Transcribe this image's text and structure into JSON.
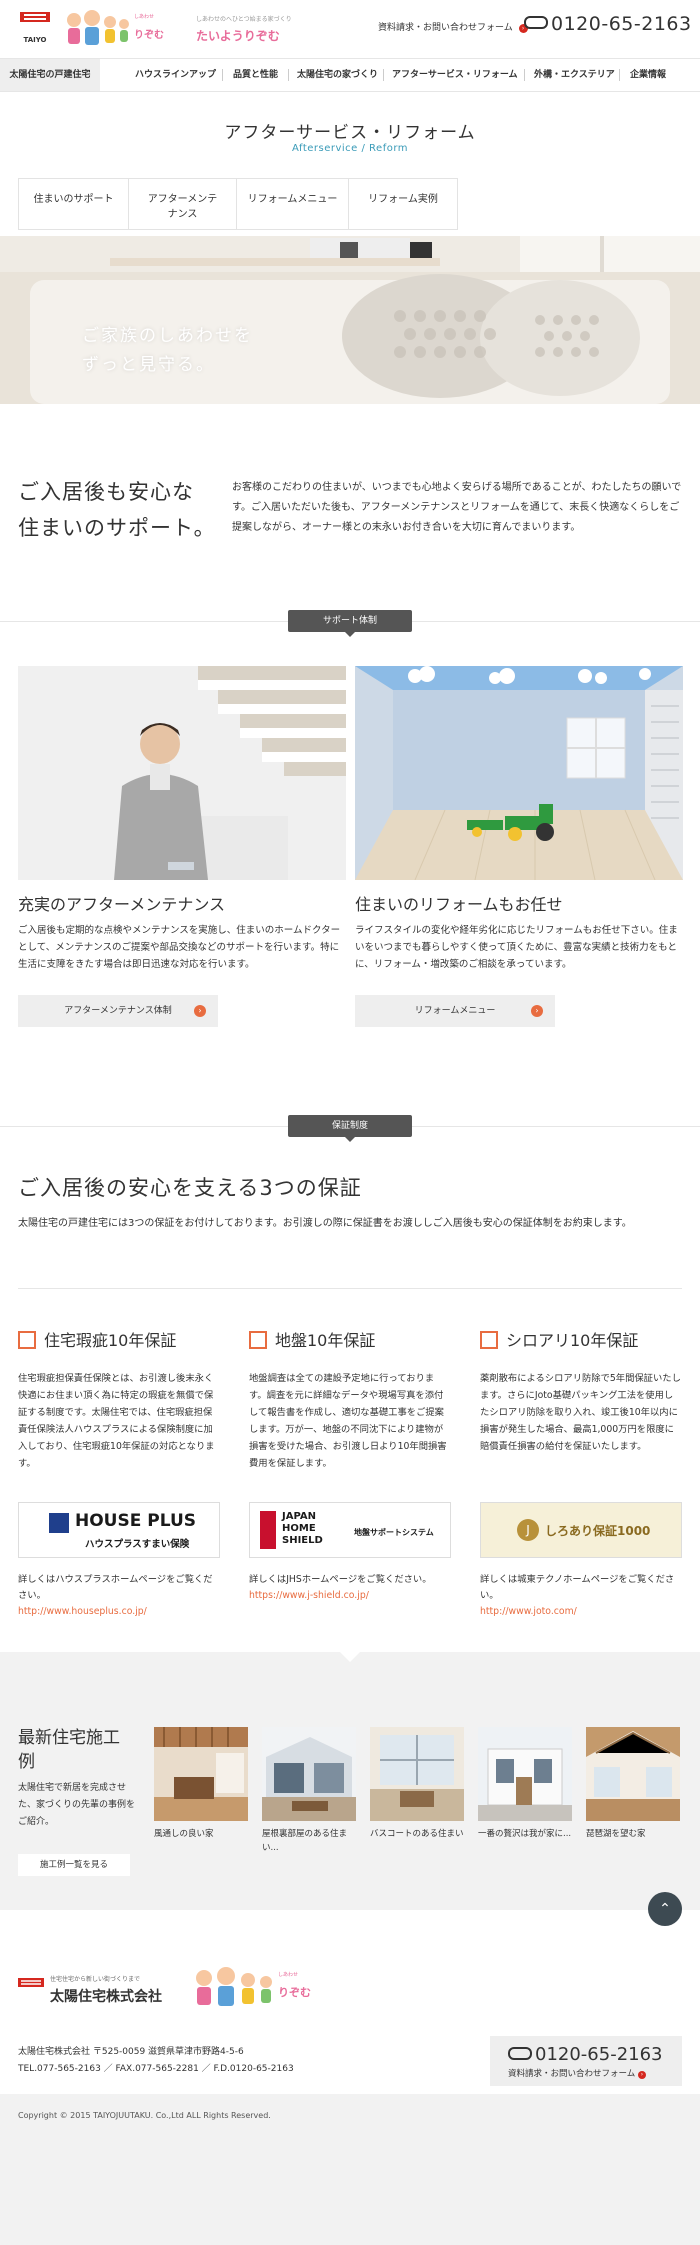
{
  "header": {
    "logo_text": "TAIYO",
    "tagline": "しあわせのへひとつ始まる家づくり",
    "brand_small": "たいようりぞむ",
    "inquiry_link": "資料請求・お問い合わせフォーム",
    "tel": "0120-65-2163"
  },
  "global_nav": {
    "current": "太陽住宅の戸建住宅",
    "items": [
      "ハウスラインアップ",
      "品質と性能",
      "太陽住宅の家づくり",
      "アフターサービス・リフォーム",
      "外構・エクステリア",
      "企業情報"
    ]
  },
  "page": {
    "title": "アフターサービス・リフォーム",
    "subtitle": "Afterservice / Reform"
  },
  "local_nav": [
    {
      "label": "住まいのサポート"
    },
    {
      "label": "アフターメンテナンス"
    },
    {
      "label": "リフォームメニュー"
    },
    {
      "label": "リフォーム実例"
    }
  ],
  "hero": {
    "line1": "ご家族のしあわせを",
    "line2": "ずっと見守る。"
  },
  "intro": {
    "heading1": "ご入居後も安心な",
    "heading2": "住まいのサポート。",
    "body": "お客様のこだわりの住まいが、いつまでも心地よく安らげる場所であることが、わたしたちの願いです。ご入居いただいた後も、アフターメンテナンスとリフォームを通じて、末長く快適なくらしをご提案しながら、オーナー様との末永いお付き合いを大切に育んでまいります。"
  },
  "support": {
    "label": "サポート体制",
    "cards": [
      {
        "title": "充実のアフターメンテナンス",
        "body": "ご入居後も定期的な点検やメンテナンスを実施し、住まいのホームドクターとして、メンテナンスのご提案や部品交換などのサポートを行います。特に生活に支障をきたす場合は即日迅速な対応を行います。",
        "button": "アフターメンテナンス体制"
      },
      {
        "title": "住まいのリフォームもお任せ",
        "body": "ライフスタイルの変化や経年劣化に応じたリフォームもお任せ下さい。住まいをいつまでも暮らしやすく使って頂くために、豊富な実績と技術力をもとに、リフォーム・増改築のご相談を承っています。",
        "button": "リフォームメニュー"
      }
    ]
  },
  "warranty": {
    "label": "保証制度",
    "heading": "ご入居後の安心を支える3つの保証",
    "body": "太陽住宅の戸建住宅には3つの保証をお付けしております。お引渡しの際に保証書をお渡ししご入居後も安心の保証体制をお約束します。",
    "items": [
      {
        "title": "住宅瑕疵10年保証",
        "body": "住宅瑕疵担保責任保険とは、お引渡し後末永く快適にお住まい頂く為に特定の瑕疵を無償で保証する制度です。太陽住宅では、住宅瑕疵担保責任保険法人ハウスプラスによる保険制度に加入しており、住宅瑕疵10年保証の対応となります。",
        "banner_main": "HOUSE PLUS",
        "banner_sub": "ハウスプラスすまい保険",
        "detail": "詳しくはハウスプラスホームページをご覧ください。",
        "url": "http://www.houseplus.co.jp/"
      },
      {
        "title": "地盤10年保証",
        "body": "地盤調査は全ての建設予定地に行っております。調査を元に詳細なデータや現場写真を添付して報告書を作成し、適切な基礎工事をご提案します。万が一、地盤の不同沈下により建物が損害を受けた場合、お引渡し日より10年間損害費用を保証します。",
        "banner_main": "JAPAN HOME SHIELD",
        "banner_sub": "地盤サポートシステム",
        "detail": "詳しくはJHSホームページをご覧ください。",
        "url": "https://www.j-shield.co.jp/"
      },
      {
        "title": "シロアリ10年保証",
        "body": "薬剤散布によるシロアリ防除で5年間保証いたします。さらにJoto基礎パッキング工法を使用したシロアリ防除を取り入れ、竣工後10年以内に損害が発生した場合、最高1,000万円を限度に賠償責任損害の給付を保証いたします。",
        "banner_main": "しろあり保証1000",
        "banner_sub": "",
        "detail": "詳しくは城東テクノホームページをご覧ください。",
        "url": "http://www.joto.com/"
      }
    ]
  },
  "works": {
    "heading1": "最新住宅施工",
    "heading2": "例",
    "body": "太陽住宅で新居を完成させた、家づくりの先輩の事例をご紹介。",
    "button": "施工例一覧を見る",
    "items": [
      {
        "caption": "風通しの良い家"
      },
      {
        "caption": "屋根裏部屋のある住まい..."
      },
      {
        "caption": "バスコートのある住まい"
      },
      {
        "caption": "一番の贅沢は我が家に..."
      },
      {
        "caption": "琵琶湖を望む家"
      }
    ]
  },
  "footer": {
    "company_tag": "住宅住宅から新しい街づくりまで",
    "company": "太陽住宅株式会社",
    "address1": "太陽住宅株式会社 〒525-0059 滋賀県草津市野路4-5-6",
    "address2": "TEL.077-565-2163 ／ FAX.077-565-2281 ／ F.D.0120-65-2163",
    "tel": "0120-65-2163",
    "tel_link": "資料請求・お問い合わせフォーム",
    "copyright": "Copyright © 2015 TAIYOJUUTAKU. Co.,Ltd ALL Rights Reserved."
  },
  "colors": {
    "accent": "#e86c40",
    "link_blue": "#3a9bb8",
    "dark": "#555555",
    "logo_red": "#d5281f"
  }
}
